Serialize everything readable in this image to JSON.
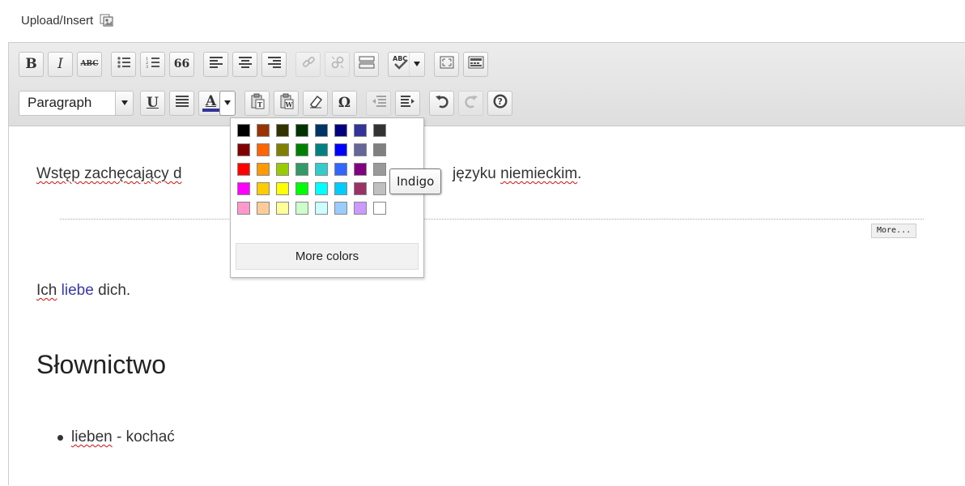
{
  "upload": {
    "label": "Upload/Insert"
  },
  "toolbar": {
    "bold": "B",
    "italic": "I",
    "strikethrough": "ABC",
    "blockquote": "66",
    "format_select": "Paragraph",
    "underline": "U",
    "text_color_letter": "A",
    "special_char": "Ω"
  },
  "text_color": {
    "current": "#333399"
  },
  "color_picker": {
    "colors": [
      "#000000",
      "#993300",
      "#333300",
      "#003300",
      "#003366",
      "#000080",
      "#333399",
      "#333333",
      "#800000",
      "#ff6600",
      "#808000",
      "#008000",
      "#008080",
      "#0000ff",
      "#666699",
      "#808080",
      "#ff0000",
      "#ff9900",
      "#99cc00",
      "#339966",
      "#33cccc",
      "#3366ff",
      "#800080",
      "#999999",
      "#ff00ff",
      "#ffcc00",
      "#ffff00",
      "#00ff00",
      "#00ffff",
      "#00ccff",
      "#993366",
      "#c0c0c0",
      "#ff99cc",
      "#ffcc99",
      "#ffff99",
      "#ccffcc",
      "#ccffff",
      "#99ccff",
      "#cc99ff",
      "#ffffff"
    ],
    "more_label": "More colors",
    "tooltip": "Indigo"
  },
  "content": {
    "intro_left": "Wstęp zachęcający d",
    "intro_right_prefix": "języku ",
    "intro_right_word": "niemieckim",
    "intro_right_suffix": ".",
    "more_tag": "More...",
    "p2_ich": "Ich",
    "p2_liebe": "liebe",
    "p2_dich": " dich.",
    "heading": "Słownictwo",
    "item_word": "lieben",
    "item_rest": " - kochać"
  }
}
